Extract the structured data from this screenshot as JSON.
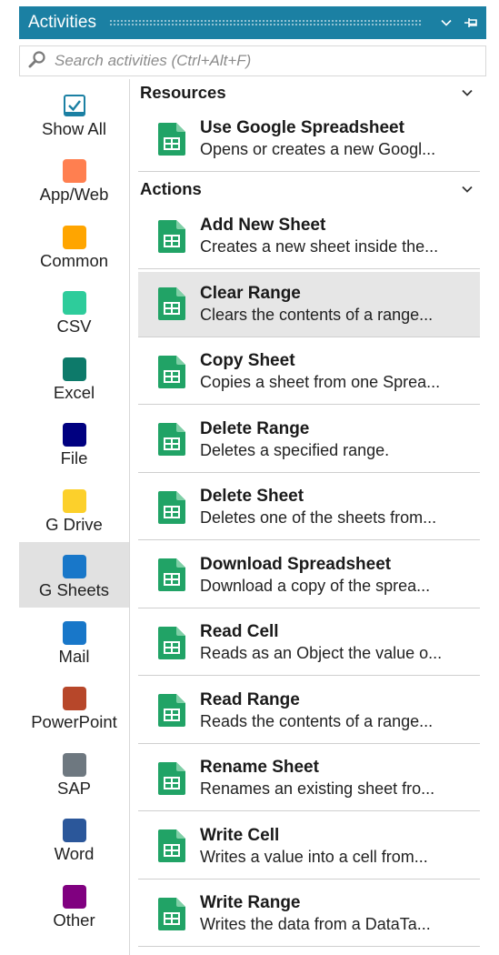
{
  "panel": {
    "title": "Activities"
  },
  "search": {
    "placeholder": "Search activities (Ctrl+Alt+F)"
  },
  "categories": [
    {
      "label": "Show All",
      "icon": "checkbox-icon",
      "color": "#1b80a3"
    },
    {
      "label": "App/Web",
      "color": "#ff7f50"
    },
    {
      "label": "Common",
      "color": "#ffa500"
    },
    {
      "label": "CSV",
      "color": "#2ecc9b"
    },
    {
      "label": "Excel",
      "color": "#0d7a6a"
    },
    {
      "label": "File",
      "color": "#000080"
    },
    {
      "label": "G Drive",
      "color": "#fcd02b"
    },
    {
      "label": "G Sheets",
      "color": "#1877c9",
      "selected": true
    },
    {
      "label": "Mail",
      "color": "#1877c9"
    },
    {
      "label": "PowerPoint",
      "color": "#b7472a"
    },
    {
      "label": "SAP",
      "color": "#6e7880"
    },
    {
      "label": "Word",
      "color": "#2b579a"
    },
    {
      "label": "Other",
      "color": "#800080"
    }
  ],
  "sections": {
    "resources": {
      "header": "Resources",
      "items": [
        {
          "name": "Use Google Spreadsheet",
          "desc": "Opens or creates a new Googl..."
        }
      ]
    },
    "actions": {
      "header": "Actions",
      "items": [
        {
          "name": "Add New Sheet",
          "desc": "Creates a new sheet inside the..."
        },
        {
          "name": "Clear Range",
          "desc": "Clears the contents of a range...",
          "selected": true
        },
        {
          "name": "Copy Sheet",
          "desc": "Copies a sheet from one Sprea..."
        },
        {
          "name": "Delete Range",
          "desc": "Deletes a specified range."
        },
        {
          "name": "Delete Sheet",
          "desc": "Deletes one of the sheets from..."
        },
        {
          "name": "Download Spreadsheet",
          "desc": "Download a copy of the sprea..."
        },
        {
          "name": "Read Cell",
          "desc": "Reads as an Object the value o..."
        },
        {
          "name": "Read Range",
          "desc": "Reads the contents of a range..."
        },
        {
          "name": "Rename Sheet",
          "desc": "Renames an existing sheet fro..."
        },
        {
          "name": "Write Cell",
          "desc": "Writes a value into a cell from..."
        },
        {
          "name": "Write Range",
          "desc": "Writes the data from a DataTa..."
        }
      ]
    }
  },
  "colors": {
    "accent": "#1b80a3",
    "sheets_green": "#21a366",
    "selected_bg": "#e1e1e1"
  }
}
